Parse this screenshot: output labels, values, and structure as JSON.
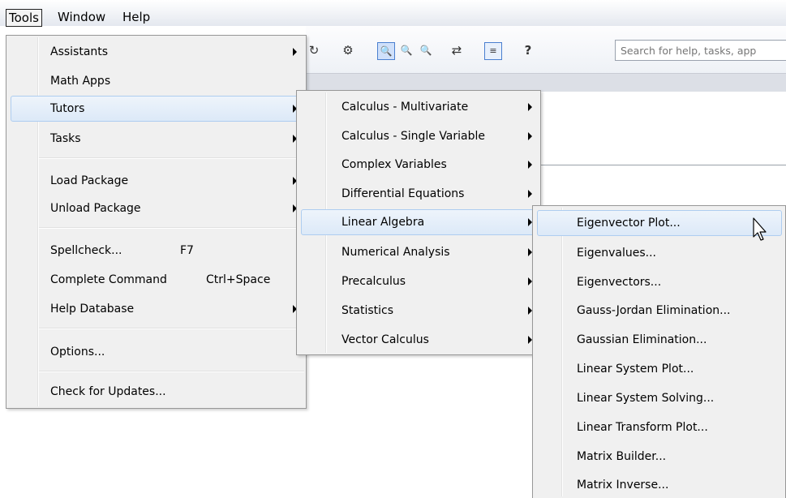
{
  "menubar": {
    "tools": "Tools",
    "window": "Window",
    "help": "Help"
  },
  "toolbar": {
    "search_placeholder": "Search for help, tasks, app",
    "icons": [
      "gear-icon",
      "zoom-100-icon",
      "zoom-in-icon",
      "zoom-out-icon",
      "swap-icon",
      "insert-math-icon",
      "help-icon"
    ]
  },
  "tools_menu": {
    "items": [
      {
        "label": "Assistants",
        "shortcut": "",
        "submenu": true
      },
      {
        "label": "Math Apps",
        "shortcut": "",
        "submenu": false
      },
      {
        "label": "Tutors",
        "shortcut": "",
        "submenu": true,
        "highlighted": true
      },
      {
        "label": "Tasks",
        "shortcut": "",
        "submenu": true
      },
      {
        "label": "Load Package",
        "shortcut": "",
        "submenu": true
      },
      {
        "label": "Unload Package",
        "shortcut": "",
        "submenu": true
      },
      {
        "label": "Spellcheck...",
        "shortcut": "F7",
        "submenu": false
      },
      {
        "label": "Complete Command",
        "shortcut": "Ctrl+Space",
        "submenu": false
      },
      {
        "label": "Help Database",
        "shortcut": "",
        "submenu": true
      },
      {
        "label": "Options...",
        "shortcut": "",
        "submenu": false
      },
      {
        "label": "Check for Updates...",
        "shortcut": "",
        "submenu": false
      }
    ]
  },
  "tutors_menu": {
    "items": [
      {
        "label": "Calculus - Multivariate",
        "submenu": true
      },
      {
        "label": "Calculus - Single Variable",
        "submenu": true
      },
      {
        "label": "Complex Variables",
        "submenu": true
      },
      {
        "label": "Differential Equations",
        "submenu": true
      },
      {
        "label": "Linear Algebra",
        "submenu": true,
        "highlighted": true
      },
      {
        "label": "Numerical Analysis",
        "submenu": true
      },
      {
        "label": "Precalculus",
        "submenu": true
      },
      {
        "label": "Statistics",
        "submenu": true
      },
      {
        "label": "Vector Calculus",
        "submenu": true
      }
    ]
  },
  "linear_algebra_menu": {
    "items": [
      {
        "label": "Eigenvector Plot...",
        "highlighted": true
      },
      {
        "label": "Eigenvalues..."
      },
      {
        "label": "Eigenvectors..."
      },
      {
        "label": "Gauss-Jordan Elimination..."
      },
      {
        "label": "Gaussian Elimination..."
      },
      {
        "label": "Linear System Plot..."
      },
      {
        "label": "Linear System Solving..."
      },
      {
        "label": "Linear Transform Plot..."
      },
      {
        "label": "Matrix Builder..."
      },
      {
        "label": "Matrix Inverse..."
      }
    ]
  },
  "colors": {
    "highlight": "#dce9f8",
    "highlight_border": "#aecdf0",
    "menu_bg": "#f0f0f0"
  }
}
